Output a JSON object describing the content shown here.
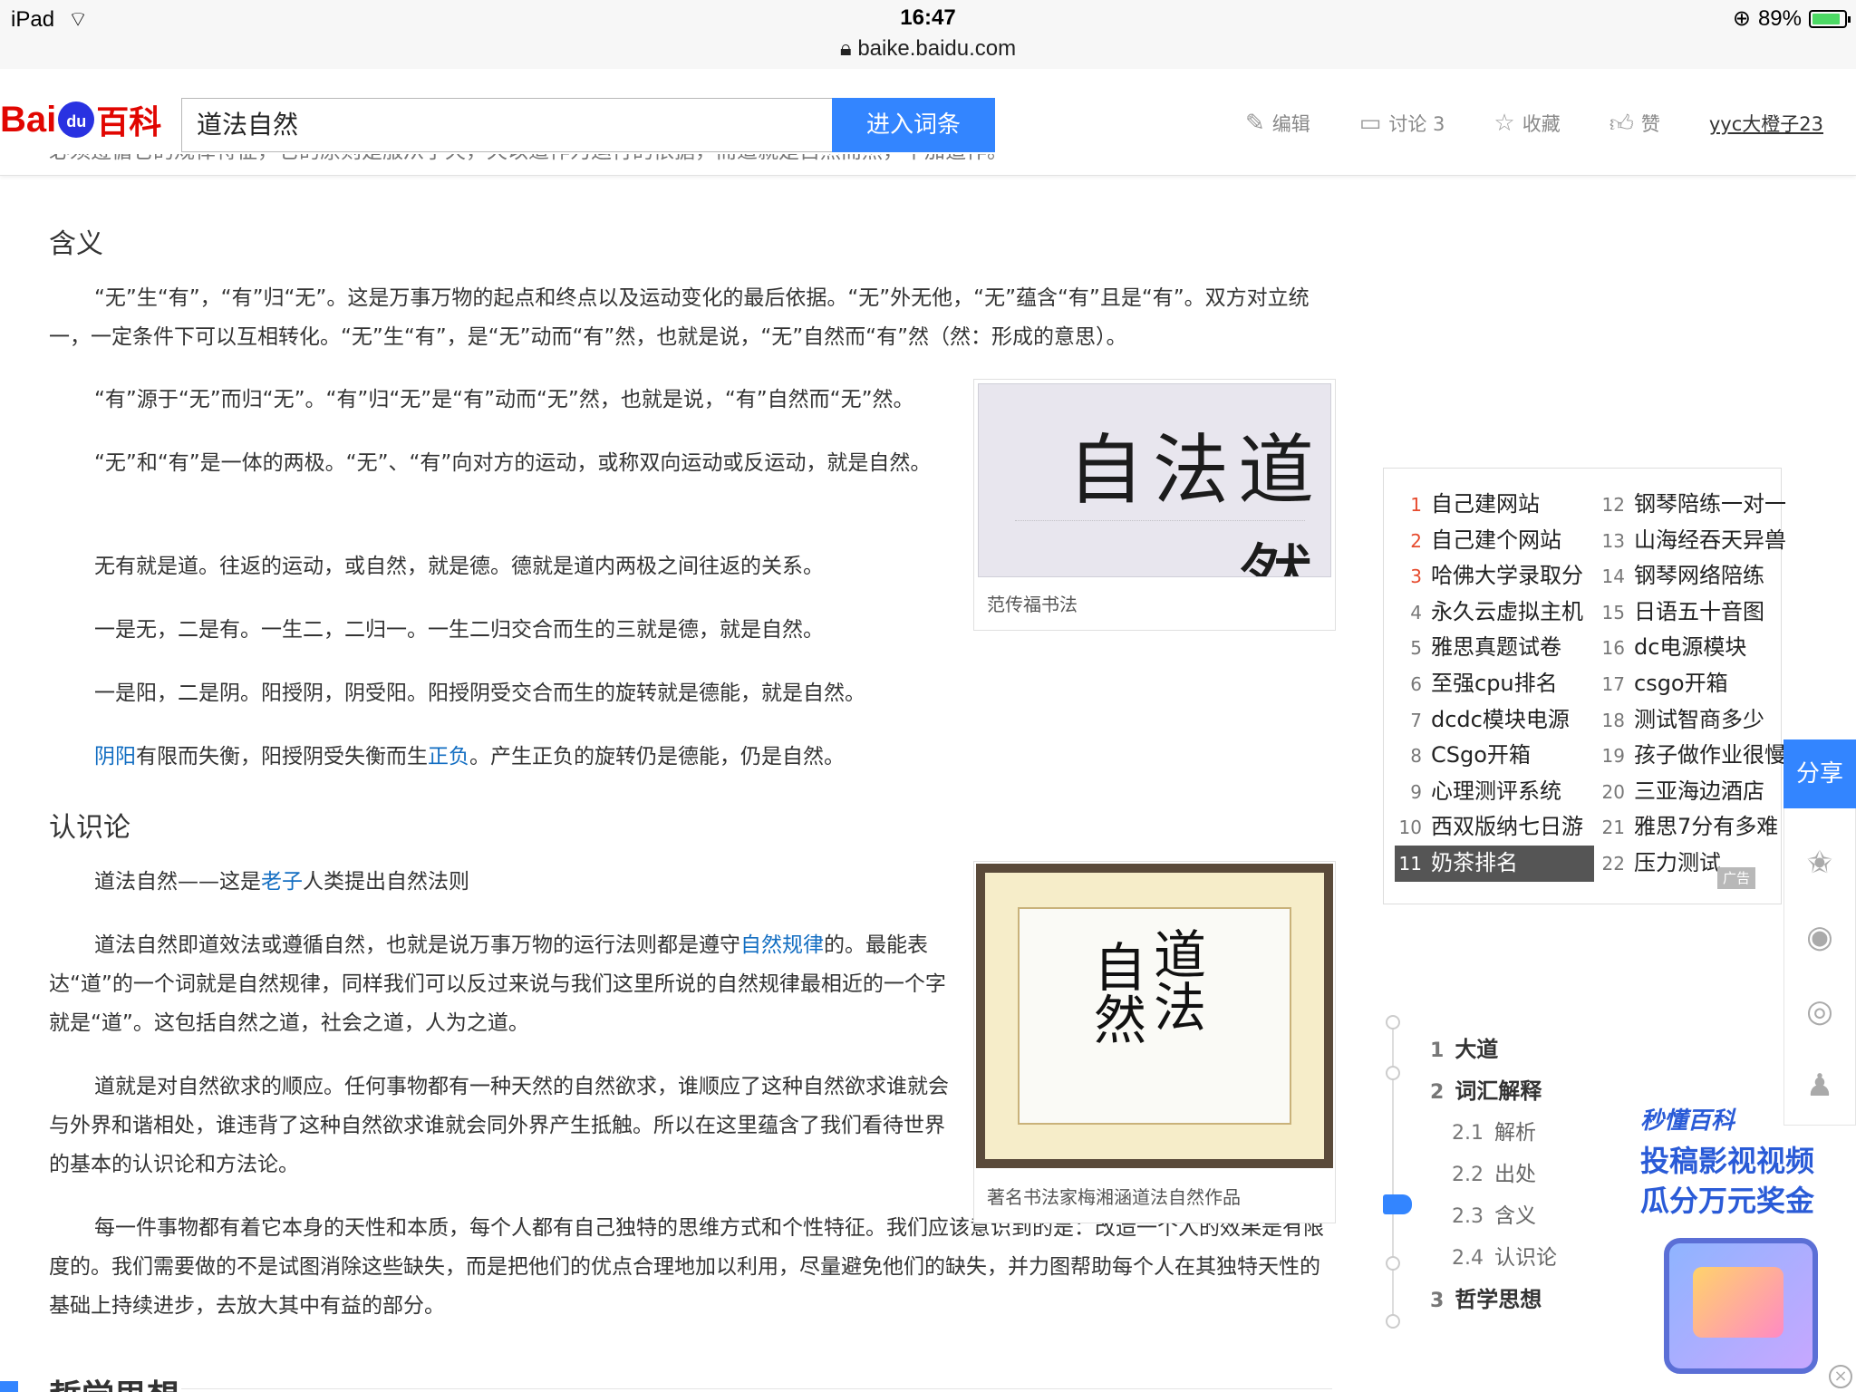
{
  "status_bar": {
    "device": "iPad",
    "time": "16:47",
    "url": "baike.baidu.com",
    "battery": "89%",
    "battery_level": 0.89
  },
  "header": {
    "logo_bai": "Bai",
    "logo_du": "du",
    "logo_baike": "百科",
    "search_value": "道法自然",
    "search_button": "进入词条",
    "actions": {
      "edit": "编辑",
      "discuss": "讨论 3",
      "favorite": "收藏",
      "like": "赞"
    },
    "user": "yyc大橙子23"
  },
  "article": {
    "cut_line": "必须遵循它的规律特征，它的原则是服从于天，天以道作为运行的依据，而道就是自然而然，不加造作。",
    "section_meaning": "含义",
    "p1": "“无”生“有”，“有”归“无”。这是万事万物的起点和终点以及运动变化的最后依据。“无”外无他，“无”蕴含“有”且是“有”。双方对立统一，一定条件下可以互相转化。“无”生“有”，是“无”动而“有”然，也就是说，“无”自然而“有”然（然：形成的意思）。",
    "p2": "“有”源于“无”而归“无”。“有”归“无”是“有”动而“无”然，也就是说，“有”自然而“无”然。",
    "p3": "“无”和“有”是一体的两极。“无”、“有”向对方的运动，或称双向运动或反运动，就是自然。",
    "p4": "无有就是道。往返的运动，或自然，就是德。德就是道内两极之间往返的关系。",
    "p5": "一是无，二是有。一生二，二归一。一生二归交合而生的三就是德，就是自然。",
    "p6": "一是阳，二是阴。阳授阴，阴受阳。阳授阴受交合而生的旋转就是德能，就是自然。",
    "p7_link1": "阴阳",
    "p7_mid": "有限而失衡，阳授阴受失衡而生",
    "p7_link2": "正负",
    "p7_end": "。产生正负的旋转仍是德能，仍是自然。",
    "section_epistemology": "认识论",
    "p8_start": "道法自然——这是",
    "p8_link": "老子",
    "p8_end": "人类提出自然法则",
    "p9_start": "道法自然即道效法或遵循自然，也就是说万事万物的运行法则都是遵守",
    "p9_link": "自然规律",
    "p9_end": "的。最能表达“道”的一个词就是自然规律，同样我们可以反过来说与我们这里所说的自然规律最相近的一个字就是“道”。这包括自然之道，社会之道，人为之道。",
    "p10": "道就是对自然欲求的顺应。任何事物都有一种天然的自然欲求，谁顺应了这种自然欲求谁就会与外界和谐相处，谁违背了这种自然欲求谁就会同外界产生抵触。所以在这里蕴含了我们看待世界的基本的认识论和方法论。",
    "p11": "每一件事物都有着它本身的天性和本质，每个人都有自己独特的思维方式和个性特征。我们应该意识到的是：改造一个人的效果是有限度的。我们需要做的不是试图消除这些缺失，而是把他们的优点合理地加以利用，尽量避免他们的缺失，并力图帮助每个人在其独特天性的基础上持续进步，去放大其中有益的部分。",
    "bottom_heading": "哲学思想"
  },
  "images": {
    "img1_calligraphy": "道法自然",
    "img1_caption": "范传福书法",
    "img2_calligraphy_a": "道法",
    "img2_calligraphy_b": "自然",
    "img2_caption": "著名书法家梅湘涵道法自然作品"
  },
  "hotlist": {
    "left": [
      {
        "num": "1",
        "text": "自己建网站"
      },
      {
        "num": "2",
        "text": "自己建个网站"
      },
      {
        "num": "3",
        "text": "哈佛大学录取分"
      },
      {
        "num": "4",
        "text": "永久云虚拟主机"
      },
      {
        "num": "5",
        "text": "雅思真题试卷"
      },
      {
        "num": "6",
        "text": "至强cpu排名"
      },
      {
        "num": "7",
        "text": "dcdc模块电源"
      },
      {
        "num": "8",
        "text": "CSgo开箱"
      },
      {
        "num": "9",
        "text": "心理测评系统"
      },
      {
        "num": "10",
        "text": "西双版纳七日游"
      },
      {
        "num": "11",
        "text": "奶茶排名"
      }
    ],
    "right": [
      {
        "num": "12",
        "text": "钢琴陪练一对一"
      },
      {
        "num": "13",
        "text": "山海经吞天异兽"
      },
      {
        "num": "14",
        "text": "钢琴网络陪练"
      },
      {
        "num": "15",
        "text": "日语五十音图"
      },
      {
        "num": "16",
        "text": "dc电源模块"
      },
      {
        "num": "17",
        "text": "csgo开箱"
      },
      {
        "num": "18",
        "text": "测试智商多少"
      },
      {
        "num": "19",
        "text": "孩子做作业很慢"
      },
      {
        "num": "20",
        "text": "三亚海边酒店"
      },
      {
        "num": "21",
        "text": "雅思7分有多难"
      },
      {
        "num": "22",
        "text": "压力测试"
      }
    ],
    "ad_tag": "广告"
  },
  "share": {
    "label": "分享"
  },
  "toc": {
    "items": [
      {
        "num": "1",
        "text": "大道"
      },
      {
        "num": "2",
        "text": "词汇解释"
      },
      {
        "num": "2.1",
        "text": "解析"
      },
      {
        "num": "2.2",
        "text": "出处"
      },
      {
        "num": "2.3",
        "text": "含义"
      },
      {
        "num": "2.4",
        "text": "认识论"
      },
      {
        "num": "3",
        "text": "哲学思想"
      }
    ]
  },
  "ad": {
    "brand": "秒懂百科",
    "line1": "投稿影视视频",
    "line2": "瓜分万元奖金"
  }
}
